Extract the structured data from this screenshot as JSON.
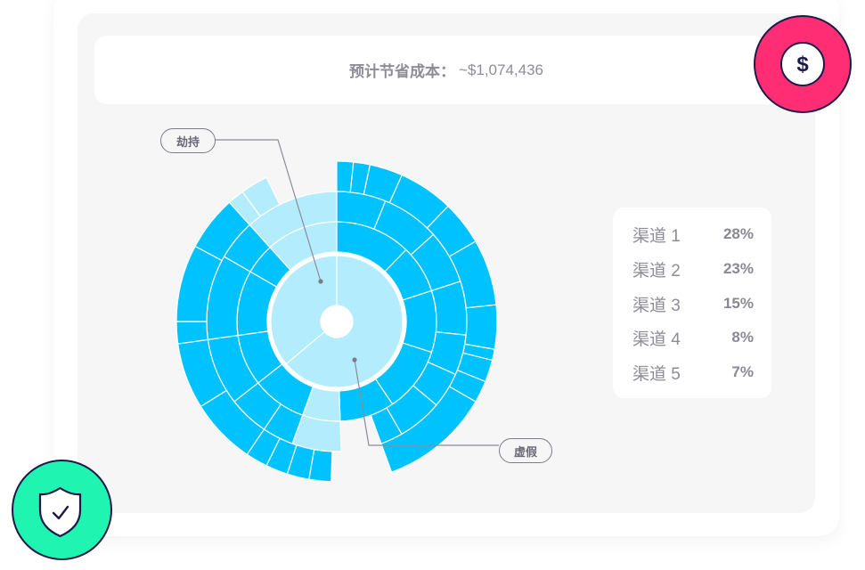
{
  "summary": {
    "label": "预计节省成本：",
    "value": "~$1,074,436"
  },
  "chart_data": {
    "type": "sunburst",
    "inner_categories": [
      {
        "label": "劫持",
        "share": 0.36
      },
      {
        "label": "虚假",
        "share": 0.64
      }
    ],
    "legend": [
      {
        "name": "渠道 1",
        "pct": "28%"
      },
      {
        "name": "渠道 2",
        "pct": "23%"
      },
      {
        "name": "渠道 3",
        "pct": "15%"
      },
      {
        "name": "渠道 4",
        "pct": "8%"
      },
      {
        "name": "渠道 5",
        "pct": "7%"
      }
    ],
    "colors": {
      "light": "#b3ecfd",
      "primary": "#00c2fe",
      "separator": "#ffffff"
    }
  },
  "badges": {
    "dollar": {
      "symbol": "$",
      "icon": "dollar-icon",
      "color": "#ff2e74"
    },
    "shield": {
      "icon": "shield-check-icon",
      "color": "#1ff5b0"
    }
  }
}
